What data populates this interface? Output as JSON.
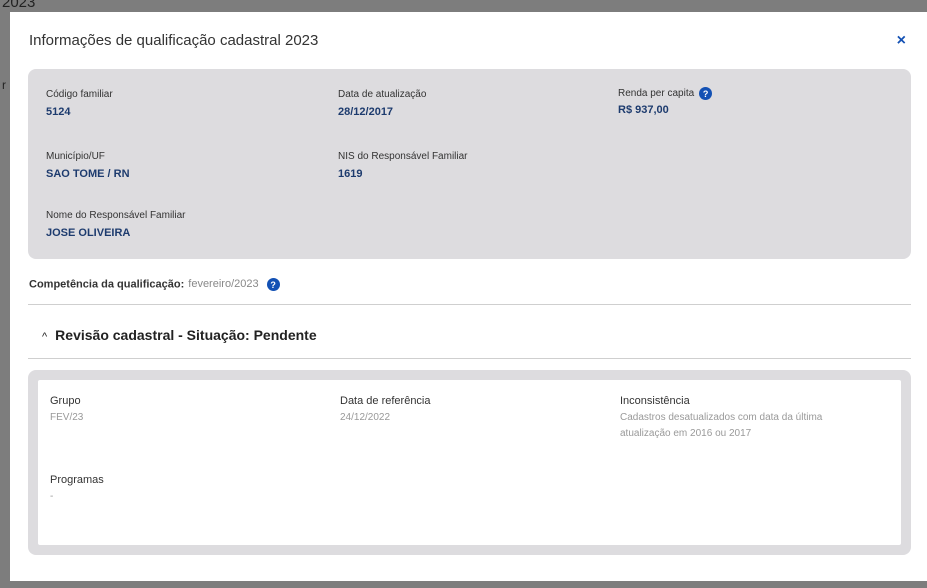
{
  "backdrop": {
    "title_fragment": "2023",
    "side_letter": "r"
  },
  "modal": {
    "title": "Informações de qualificação cadastral 2023",
    "close_label": "×"
  },
  "family": {
    "codigo_familiar": {
      "label": "Código familiar",
      "value": "5124"
    },
    "data_atualizacao": {
      "label": "Data de atualização",
      "value": "28/12/2017"
    },
    "renda_per_capita": {
      "label": "Renda per capita",
      "value": "R$ 937,00"
    },
    "municipio_uf": {
      "label": "Município/UF",
      "value": "SAO TOME / RN"
    },
    "nis_responsavel": {
      "label": "NIS do Responsável Familiar",
      "value": "1619"
    },
    "nome_responsavel": {
      "label": "Nome do Responsável Familiar",
      "value": "JOSE OLIVEIRA"
    }
  },
  "competencia": {
    "label": "Competência da qualificação:",
    "value": "fevereiro/2023"
  },
  "help_icon_glyph": "?",
  "revisao": {
    "chevron": "^",
    "title": "Revisão cadastral - Situação: Pendente",
    "grupo": {
      "label": "Grupo",
      "value": "FEV/23"
    },
    "data_referencia": {
      "label": "Data de referência",
      "value": "24/12/2022"
    },
    "inconsistencia": {
      "label": "Inconsistência",
      "value": "Cadastros desatualizados com data da última atualização em 2016 ou 2017"
    },
    "programas": {
      "label": "Programas",
      "value": "-"
    }
  },
  "colors": {
    "accent": "#1351b4",
    "value_text": "#1d3b6e",
    "panel_bg": "#dddcdf",
    "muted_text": "#999999"
  }
}
